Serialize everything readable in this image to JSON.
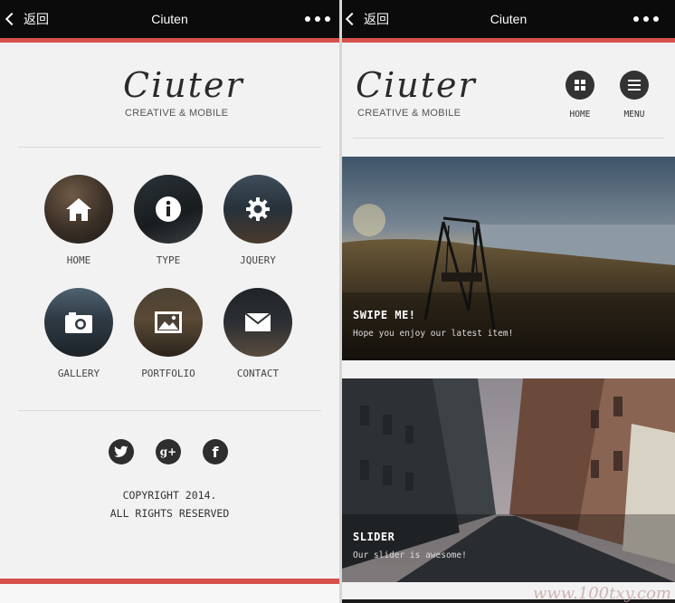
{
  "left_phone": {
    "topbar": {
      "back_label": "返回",
      "title": "Ciuten"
    },
    "logo": "Ciuter",
    "tagline": "CREATIVE & MOBILE",
    "tiles": [
      {
        "label": "HOME",
        "icon": "home-icon"
      },
      {
        "label": "TYPE",
        "icon": "info-icon"
      },
      {
        "label": "JQUERY",
        "icon": "gear-icon"
      },
      {
        "label": "GALLERY",
        "icon": "camera-icon"
      },
      {
        "label": "PORTFOLIO",
        "icon": "picture-icon"
      },
      {
        "label": "CONTACT",
        "icon": "envelope-icon"
      }
    ],
    "social": {
      "twitter": "twitter-icon",
      "google_plus": "g+",
      "facebook": "f"
    },
    "copyright_line1": "COPYRIGHT 2014.",
    "copyright_line2": "ALL RIGHTS RESERVED"
  },
  "right_phone": {
    "topbar": {
      "back_label": "返回",
      "title": "Ciuten"
    },
    "logo": "Ciuter",
    "tagline": "CREATIVE & MOBILE",
    "nav": {
      "home_label": "HOME",
      "menu_label": "MENU"
    },
    "slides": [
      {
        "title": "SWIPE ME!",
        "subtitle": "Hope you enjoy our latest item!"
      },
      {
        "title": "SLIDER",
        "subtitle": "Our slider is awesome!"
      }
    ]
  },
  "watermark": "www.100txy.com",
  "colors": {
    "accent": "#d6504c",
    "topbar": "#0b0b0b",
    "background": "#f2f2f2"
  }
}
